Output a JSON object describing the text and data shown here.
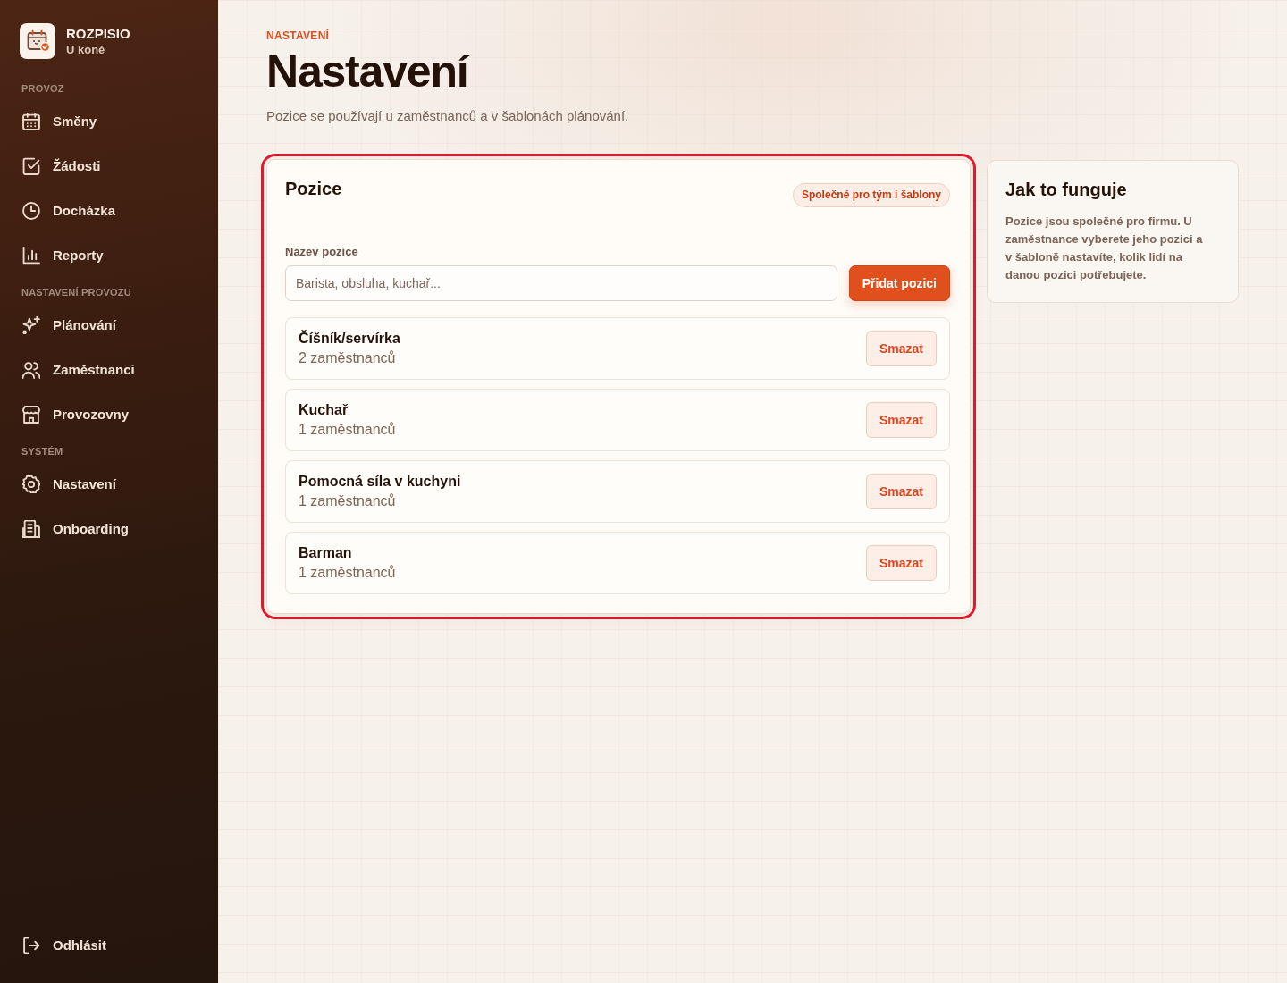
{
  "sidebar": {
    "brand": {
      "name": "ROZPISIO",
      "subtitle": "U koně"
    },
    "sections": [
      {
        "title": "PROVOZ",
        "items": [
          {
            "label": "Směny",
            "selected": false
          },
          {
            "label": "Žádosti",
            "selected": false
          },
          {
            "label": "Docházka",
            "selected": false
          },
          {
            "label": "Reporty",
            "selected": false
          }
        ]
      },
      {
        "title": "NASTAVENÍ PROVOZU",
        "items": [
          {
            "label": "Plánování",
            "selected": false
          },
          {
            "label": "Zaměstnanci",
            "selected": false
          },
          {
            "label": "Provozovny",
            "selected": false
          }
        ]
      },
      {
        "title": "SYSTÉM",
        "items": [
          {
            "label": "Nastavení",
            "selected": false
          },
          {
            "label": "Onboarding",
            "selected": false
          }
        ]
      }
    ],
    "logout": {
      "label": "Odhlásit"
    }
  },
  "header": {
    "eyebrow": "NASTAVENÍ",
    "title": "Nastavení",
    "description": "Pozice se používají u zaměstnanců a v šablonách plánování."
  },
  "positions_card": {
    "title": "Pozice",
    "highlighted": true,
    "badge": "Společné pro tým i šablony",
    "form": {
      "label": "Název pozice",
      "placeholder": "Barista, obsluha, kuchař...",
      "submit_button": "Přidat pozici"
    },
    "positions": [
      {
        "name": "Číšník/servírka",
        "count": "2 zaměstnanců",
        "delete_button": "Smazat"
      },
      {
        "name": "Kuchař",
        "count": "1 zaměstnanců",
        "delete_button": "Smazat"
      },
      {
        "name": "Pomocná síla v kuchyni",
        "count": "1 zaměstnanců",
        "delete_button": "Smazat"
      },
      {
        "name": "Barman",
        "count": "1 zaměstnanců",
        "delete_button": "Smazat"
      }
    ]
  },
  "help_panel": {
    "title": "Jak to funguje",
    "text": "Pozice jsou společné pro firmu. U zaměstnance vyberete jeho pozici a v šabloně nastavíte, kolik lidí na danou pozici potřebujete."
  }
}
